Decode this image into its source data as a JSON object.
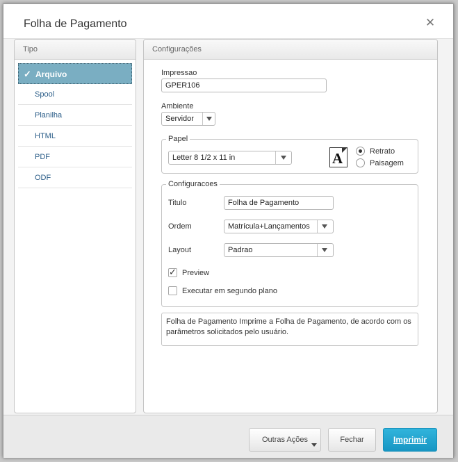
{
  "window": {
    "title": "Folha de Pagamento"
  },
  "sidebar": {
    "header": "Tipo",
    "items": [
      {
        "label": "Arquivo",
        "active": true
      },
      {
        "label": "Spool"
      },
      {
        "label": "Planilha"
      },
      {
        "label": "HTML"
      },
      {
        "label": "PDF"
      },
      {
        "label": "ODF"
      }
    ]
  },
  "main": {
    "header": "Configurações",
    "impressao": {
      "label": "Impressao",
      "value": "GPER106"
    },
    "ambiente": {
      "label": "Ambiente",
      "value": "Servidor"
    },
    "papel": {
      "legend": "Papel",
      "value": "Letter 8 1/2 x 11 in",
      "icon_letter": "A",
      "orientation": {
        "options": [
          "Retrato",
          "Paisagem"
        ],
        "selected": "Retrato"
      }
    },
    "config": {
      "legend": "Configuracoes",
      "titulo": {
        "label": "Titulo",
        "value": "Folha de Pagamento"
      },
      "ordem": {
        "label": "Ordem",
        "value": "Matrícula+Lançamentos"
      },
      "layout": {
        "label": "Layout",
        "value": "Padrao"
      },
      "preview": {
        "label": "Preview",
        "checked": true
      },
      "background": {
        "label": "Executar em segundo plano",
        "checked": false
      }
    },
    "description": "Folha de Pagamento Imprime a Folha de Pagamento, de acordo com os parâmetros solicitados pelo usuário."
  },
  "footer": {
    "other_actions": "Outras Ações",
    "close": "Fechar",
    "print": "Imprimir"
  },
  "colors": {
    "accent": "#1ea6d3",
    "active_item": "#7aaec2"
  }
}
